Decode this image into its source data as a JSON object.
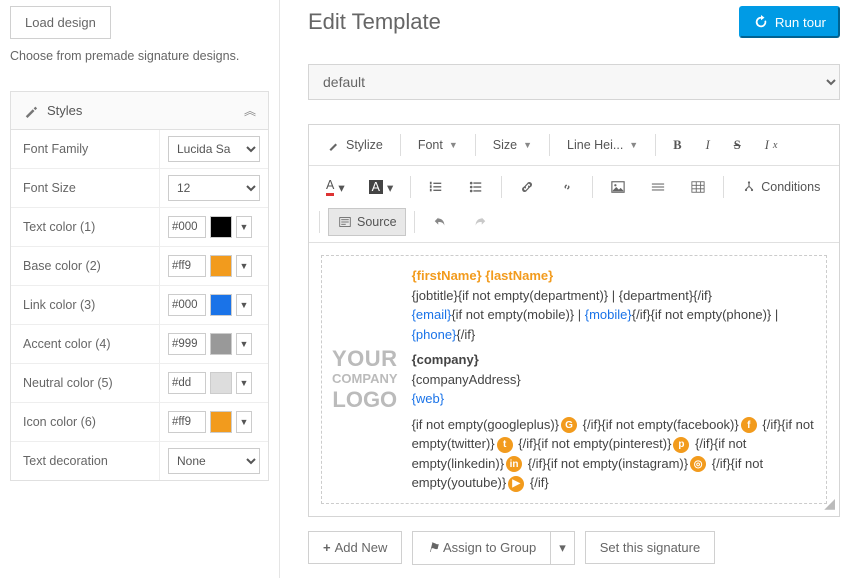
{
  "sidebar": {
    "load_design_label": "Load design",
    "load_design_desc": "Choose from premade signature designs.",
    "styles_title": "Styles",
    "rows": [
      {
        "label": "Font Family",
        "type": "select",
        "value": "Lucida Sa"
      },
      {
        "label": "Font Size",
        "type": "select",
        "value": "12"
      },
      {
        "label": "Text color (1)",
        "type": "color",
        "hex": "#000",
        "swatch": "#000000"
      },
      {
        "label": "Base color (2)",
        "type": "color",
        "hex": "#ff9",
        "swatch": "#f29b1d"
      },
      {
        "label": "Link color (3)",
        "type": "color",
        "hex": "#000",
        "swatch": "#1a73e8"
      },
      {
        "label": "Accent color (4)",
        "type": "color",
        "hex": "#999",
        "swatch": "#999999"
      },
      {
        "label": "Neutral color (5)",
        "type": "color",
        "hex": "#dd",
        "swatch": "#dddddd"
      },
      {
        "label": "Icon color (6)",
        "type": "color",
        "hex": "#ff9",
        "swatch": "#f29b1d"
      },
      {
        "label": "Text decoration",
        "type": "select",
        "value": "None"
      }
    ]
  },
  "header": {
    "title": "Edit Template",
    "run_tour": "Run tour"
  },
  "template_select": {
    "value": "default"
  },
  "toolbar": {
    "stylize": "Stylize",
    "font": "Font",
    "size": "Size",
    "lineh": "Line Hei...",
    "conditions": "Conditions",
    "source": "Source"
  },
  "logo": {
    "l1": "YOUR",
    "l2": "COMPANY",
    "l3": "LOGO"
  },
  "template_body": {
    "line1_first": "{firstName}",
    "line1_last": "{lastName}",
    "line2a": "{jobtitle}{if not empty(department)}",
    "line2b": "{department}{/if}",
    "line3a": "{email}",
    "line3b": "{if not empty(mobile)}",
    "line3c": "{mobile}",
    "line3d": "{/if}{if not empty(phone)}",
    "line3e": "{phone}",
    "line3f": "{/if}",
    "line4a": "{company}",
    "line4b": "{companyAddress}",
    "line4c": "{web}",
    "soc_gp": "{if not empty(googleplus)}",
    "soc_fb": " {/if}{if not empty(facebook)}",
    "soc_tw": " {/if}{if not empty(twitter)}",
    "soc_pin": " {/if}{if not empty(pinterest)}",
    "soc_li": " {/if}{if not empty(linkedin)}",
    "soc_ig": " {/if}{if not empty(instagram)}",
    "soc_yt": " {/if}{if not empty(youtube)}",
    "soc_end": " {/if}"
  },
  "bottom": {
    "add_new": "Add New",
    "assign": "Assign to Group",
    "set_sig": "Set this signature"
  }
}
